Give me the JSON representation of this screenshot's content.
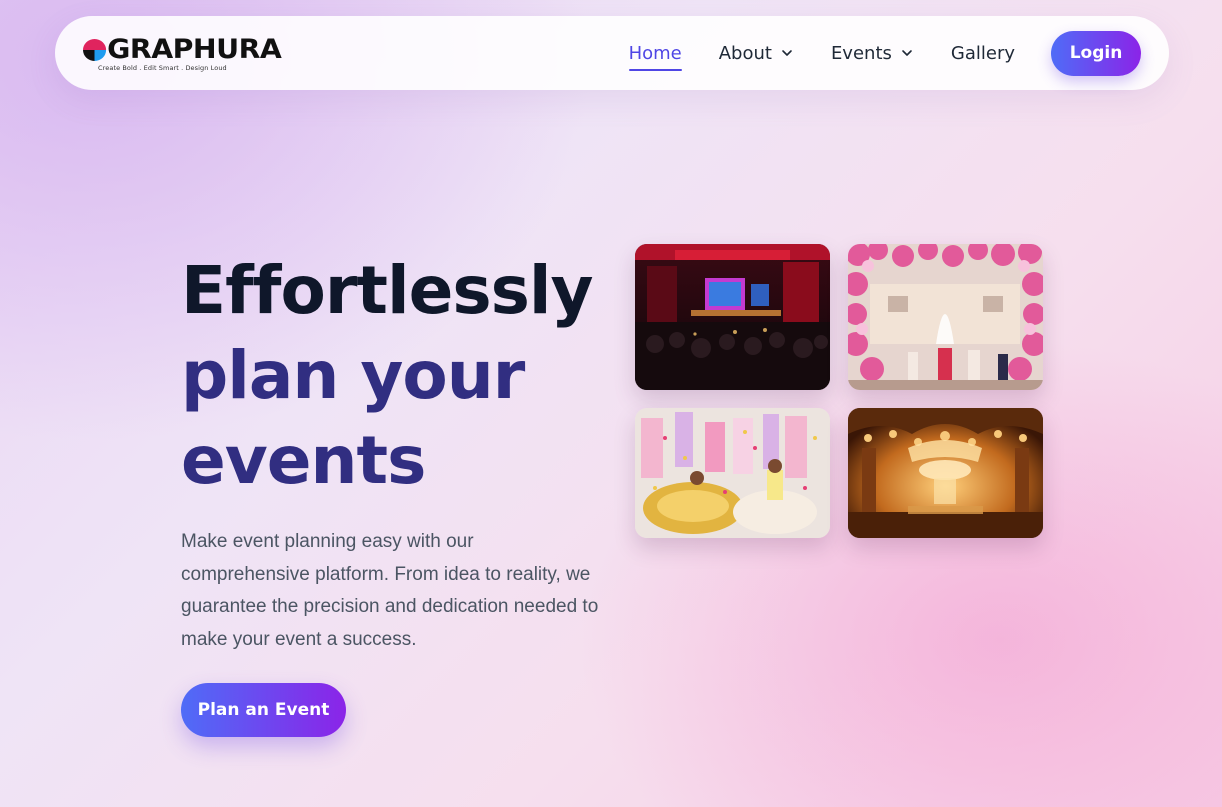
{
  "brand": {
    "name": "GRAPHURA",
    "tagline": "Create Bold . Edit Smart . Design Loud"
  },
  "nav": {
    "items": [
      {
        "label": "Home",
        "active": true
      },
      {
        "label": "About",
        "dropdown": true
      },
      {
        "label": "Events",
        "dropdown": true
      },
      {
        "label": "Gallery"
      }
    ],
    "login_label": "Login"
  },
  "hero": {
    "title_line1": "Effortlessly",
    "title_line2": "plan your",
    "title_line3": "events",
    "description": "Make event planning easy with our comprehensive platform. From idea to reality, we guarantee the precision and dedication needed to make your event a success.",
    "cta_label": "Plan an Event"
  },
  "gallery": {
    "images": [
      {
        "subject": "conference-stage-photo"
      },
      {
        "subject": "floral-wedding-mandap-photo"
      },
      {
        "subject": "celebration-dance-photo"
      },
      {
        "subject": "golden-lit-wedding-hall-photo"
      }
    ]
  },
  "colors": {
    "accent": "#4f46e5",
    "gradient_start": "#4f6cf7",
    "gradient_end": "#8b24e8",
    "title_dark": "#0f172a",
    "title_indigo": "#312e81"
  }
}
